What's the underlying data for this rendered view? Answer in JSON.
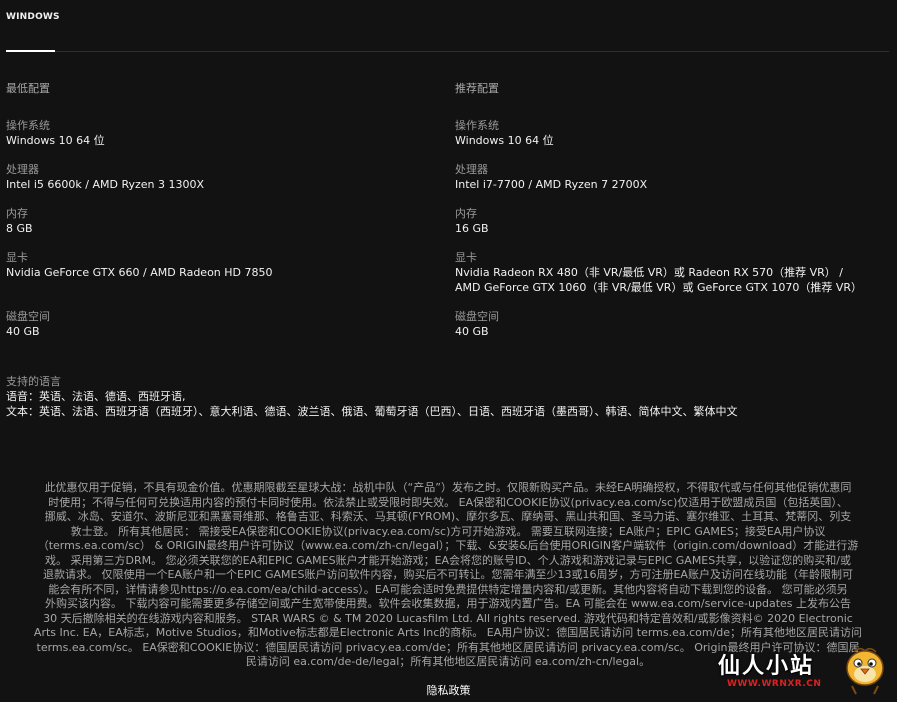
{
  "tabs": [
    {
      "label": "WINDOWS"
    }
  ],
  "min": {
    "heading": "最低配置",
    "specs": [
      {
        "label": "操作系统",
        "value": "Windows 10 64 位"
      },
      {
        "label": "处理器",
        "value": "Intel i5 6600k / AMD Ryzen 3 1300X"
      },
      {
        "label": "内存",
        "value": "8 GB"
      },
      {
        "label": "显卡",
        "value": "Nvidia GeForce GTX 660 / AMD Radeon HD 7850"
      },
      {
        "label": "磁盘空间",
        "value": "40 GB"
      }
    ]
  },
  "rec": {
    "heading": "推荐配置",
    "specs": [
      {
        "label": "操作系统",
        "value": "Windows 10 64 位"
      },
      {
        "label": "处理器",
        "value": "Intel i7-7700 / AMD Ryzen 7 2700X"
      },
      {
        "label": "内存",
        "value": "16 GB"
      },
      {
        "label": "显卡",
        "value": "Nvidia Radeon RX 480（非 VR/最低 VR）或 Radeon RX 570（推荐 VR） /",
        "value2": "AMD GeForce GTX 1060（非 VR/最低 VR）或 GeForce GTX 1070（推荐 VR）"
      },
      {
        "label": "磁盘空间",
        "value": "40 GB"
      }
    ]
  },
  "languages": {
    "heading": "支持的语言",
    "audio": "语音：英语、法语、德语、西班牙语,",
    "text": "文本：英语、法语、西班牙语（西班牙）、意大利语、德语、波兰语、俄语、葡萄牙语（巴西）、日语、西班牙语（墨西哥）、韩语、简体中文、繁体中文"
  },
  "legal": {
    "lines": [
      "此优惠仅用于促销，不具有现金价值。优惠期限截至星球大战：战机中队（“产品”）发布之时。仅限新购买产品。未经EA明确授权，不得取代或与任何其他促销优惠同",
      "时使用；不得与任何可兑换适用内容的预付卡同时使用。依法禁止或受限时即失效。 EA保密和COOKIE协议(privacy.ea.com/sc)仅适用于欧盟成员国（包括英国）、",
      "挪威、冰岛、安道尔、波斯尼亚和黑塞哥维那、格鲁吉亚、科索沃、马其顿(FYROM)、摩尔多瓦、摩纳哥、黑山共和国、圣马力诺、塞尔维亚、土耳其、梵蒂冈、列支",
      "敦士登。 所有其他居民： 需接受EA保密和COOKIE协议(privacy.ea.com/sc)方可开始游戏。 需要互联网连接；EA账户；EPIC GAMES；接受EA用户协议",
      "（terms.ea.com/sc） & ORIGIN最终用户许可协议（www.ea.com/zh-cn/legal）；下载、&安装&后台使用ORIGIN客户端软件（origin.com/download）才能进行游",
      "戏。 采用第三方DRM。 您必须关联您的EA和EPIC GAMES账户才能开始游戏；EA会将您的账号ID、个人游戏和游戏记录与EPIC GAMES共享，以验证您的购买和/或",
      "退款请求。 仅限使用一个EA账户和一个EPIC GAMES账户访问软件内容，购买后不可转让。您需年满至少13或16周岁，方可注册EA账户及访问在线功能（年龄限制可",
      "能会有所不同，详情请参见https://o.ea.com/ea/child-access）。EA可能会适时免费提供特定增量内容和/或更新。其他内容将自动下载到您的设备。 您可能必须另",
      "外购买该内容。 下载内容可能需要更多存储空间或产生宽带使用费。软件会收集数据，用于游戏内置广告。EA 可能会在 www.ea.com/service-updates 上发布公告",
      "30 天后撤除相关的在线游戏内容和服务。 STAR WARS © & TM 2020 Lucasfilm Ltd. All rights reserved. 游戏代码和特定音效和/或影像资料© 2020 Electronic",
      "Arts Inc. EA，EA标志，Motive Studios，和Motive标志都是Electronic Arts Inc的商标。 EA用户协议：德国居民请访问 terms.ea.com/de；所有其他地区居民请访问",
      "terms.ea.com/sc。 EA保密和COOKIE协议：德国居民请访问 privacy.ea.com/de；所有其他地区居民请访问 privacy.ea.com/sc。 Origin最终用户许可协议：德国居",
      "民请访问 ea.com/de-de/legal；所有其他地区居民请访问 ea.com/zh-cn/legal。"
    ],
    "privacy_link": "隐私政策"
  },
  "watermark": {
    "text": "仙人小站",
    "url": "WWW.WRNXR.CN"
  }
}
